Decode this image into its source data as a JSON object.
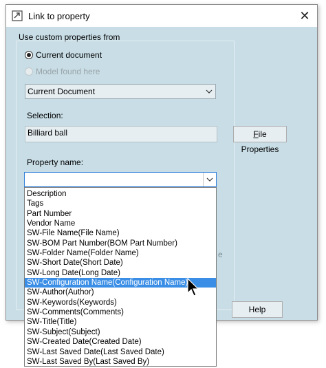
{
  "window": {
    "title": "Link to property",
    "close_symbol": "✕"
  },
  "source_group": {
    "label": "Use custom properties from",
    "radio_current": "Current document",
    "radio_model": "Model found here",
    "combo_value": "Current Document"
  },
  "selection": {
    "label": "Selection:",
    "value": "Billiard ball"
  },
  "buttons": {
    "file_properties_accel": "F",
    "file_properties_rest": "ile Properties",
    "help": "Help"
  },
  "property": {
    "label": "Property name:",
    "items": [
      "Description",
      "Tags",
      "Part Number",
      "Vendor Name",
      "SW-File Name(File Name)",
      "SW-BOM Part Number(BOM Part Number)",
      "SW-Folder Name(Folder Name)",
      "SW-Short Date(Short Date)",
      "SW-Long Date(Long Date)",
      "SW-Configuration Name(Configuration Name)",
      "SW-Author(Author)",
      "SW-Keywords(Keywords)",
      "SW-Comments(Comments)",
      "SW-Title(Title)",
      "SW-Subject(Subject)",
      "SW-Created Date(Created Date)",
      "SW-Last Saved Date(Last Saved Date)",
      "SW-Last Saved By(Last Saved By)"
    ],
    "selected_index": 9
  },
  "partial_char": "e",
  "icons": {
    "app": "link-property-icon",
    "close": "close-icon",
    "dropdown": "chevron-down-icon",
    "cursor": "mouse-pointer-icon"
  },
  "colors": {
    "dialog_bg": "#c8dde6",
    "selection_bg": "#3a8ee6",
    "focus_border": "#2f7fd8"
  }
}
